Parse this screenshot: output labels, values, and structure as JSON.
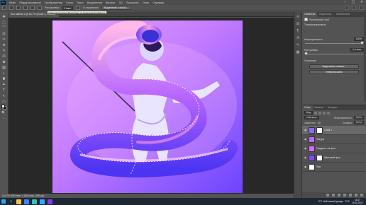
{
  "app": {
    "name": "Ps"
  },
  "menu": [
    "Файл",
    "Редактирование",
    "Изображение",
    "Слои",
    "Текст",
    "Выделение",
    "Фильтр",
    "3D",
    "Просмотр",
    "Окно",
    "Справка"
  ],
  "window_controls": [
    "–",
    "▢",
    "✕"
  ],
  "options": {
    "feather_label": "Растушевка:",
    "feather_value": "0 пикс.",
    "smoothing_label": "Сглаживание",
    "select_mask_button": "Выделение и маска..."
  },
  "document": {
    "tab_title": "Без имени-1 @ 16,7% (Слой 1, RGB/8) *",
    "tooltip": "Новое выделение (Вычитание из выделенной области)"
  },
  "toolbar_tools": [
    "⌂",
    "✥",
    "⬚",
    "⌒",
    "⊡",
    "✂",
    "⊘",
    "✎",
    "⎚",
    "✿",
    "▨",
    "◐",
    "⬮",
    "✒",
    "T",
    "↖",
    "▭",
    "✋",
    "🔍",
    "⋯"
  ],
  "status": {
    "text": "16,67%   2000 пикс. x 1800 пикс. (300 ppi)"
  },
  "properties": {
    "tabs": [
      "Свойства",
      "Корректир.",
      "Библиотеки"
    ],
    "layer_type": "Пиксельный слой",
    "transform_label": "Трансформировать",
    "opacity_label": "Непрозрачность",
    "opacity_value": "100%",
    "feather_label": "Растушевка",
    "feather_value": "0,0 пикс.",
    "refine_label": "Уточнение",
    "select_mask_button": "Выделение и маска...",
    "invert_button": "Инвертировать"
  },
  "layers": {
    "tabs": [
      "Слои",
      "Каналы",
      "Контуры"
    ],
    "filter_label": "Вид",
    "blend_mode": "Обычные",
    "opacity_label": "Непрозрачность:",
    "opacity_value": "100%",
    "lock_label": "Закрепить:",
    "fill_label": "Заливка:",
    "fill_value": "100%",
    "items": [
      {
        "name": "Слой 1",
        "thumb_color": "#8a6bff",
        "has_mask": true,
        "selected": true
      },
      {
        "name": "Фигура",
        "thumb_color": "#b96bff",
        "has_mask": false,
        "selected": false
      },
      {
        "name": "Градиент на фон",
        "thumb_color": "#d86bff",
        "has_mask": false,
        "selected": false
      },
      {
        "name": "Цветовой фон",
        "thumb_color": "#7e4bff",
        "has_mask": true,
        "selected": false
      },
      {
        "name": "Фон",
        "thumb_color": "#ffffff",
        "has_mask": false,
        "selected": false
      }
    ]
  },
  "taskbar": {
    "apps": [
      {
        "name": "file-explorer",
        "color": "#f2c14e"
      },
      {
        "name": "browser",
        "color": "#3a86ff"
      },
      {
        "name": "mail",
        "color": "#2ec4b6"
      },
      {
        "name": "photoshop",
        "color": "#31a8ff"
      },
      {
        "name": "store",
        "color": "#8338ec"
      }
    ],
    "weather": "5°C  Небольшой дождь",
    "language": "РУС",
    "time": "16:27",
    "date": "15.05.2021"
  },
  "colors": {
    "canvas_bg_top": "#e4a6ff",
    "canvas_bg_bottom": "#7b49ff",
    "tube_light": "#ffb2e6",
    "tube_mid": "#b35dff",
    "tube_dark": "#5a3cff",
    "suit": "#e8e4ff"
  }
}
